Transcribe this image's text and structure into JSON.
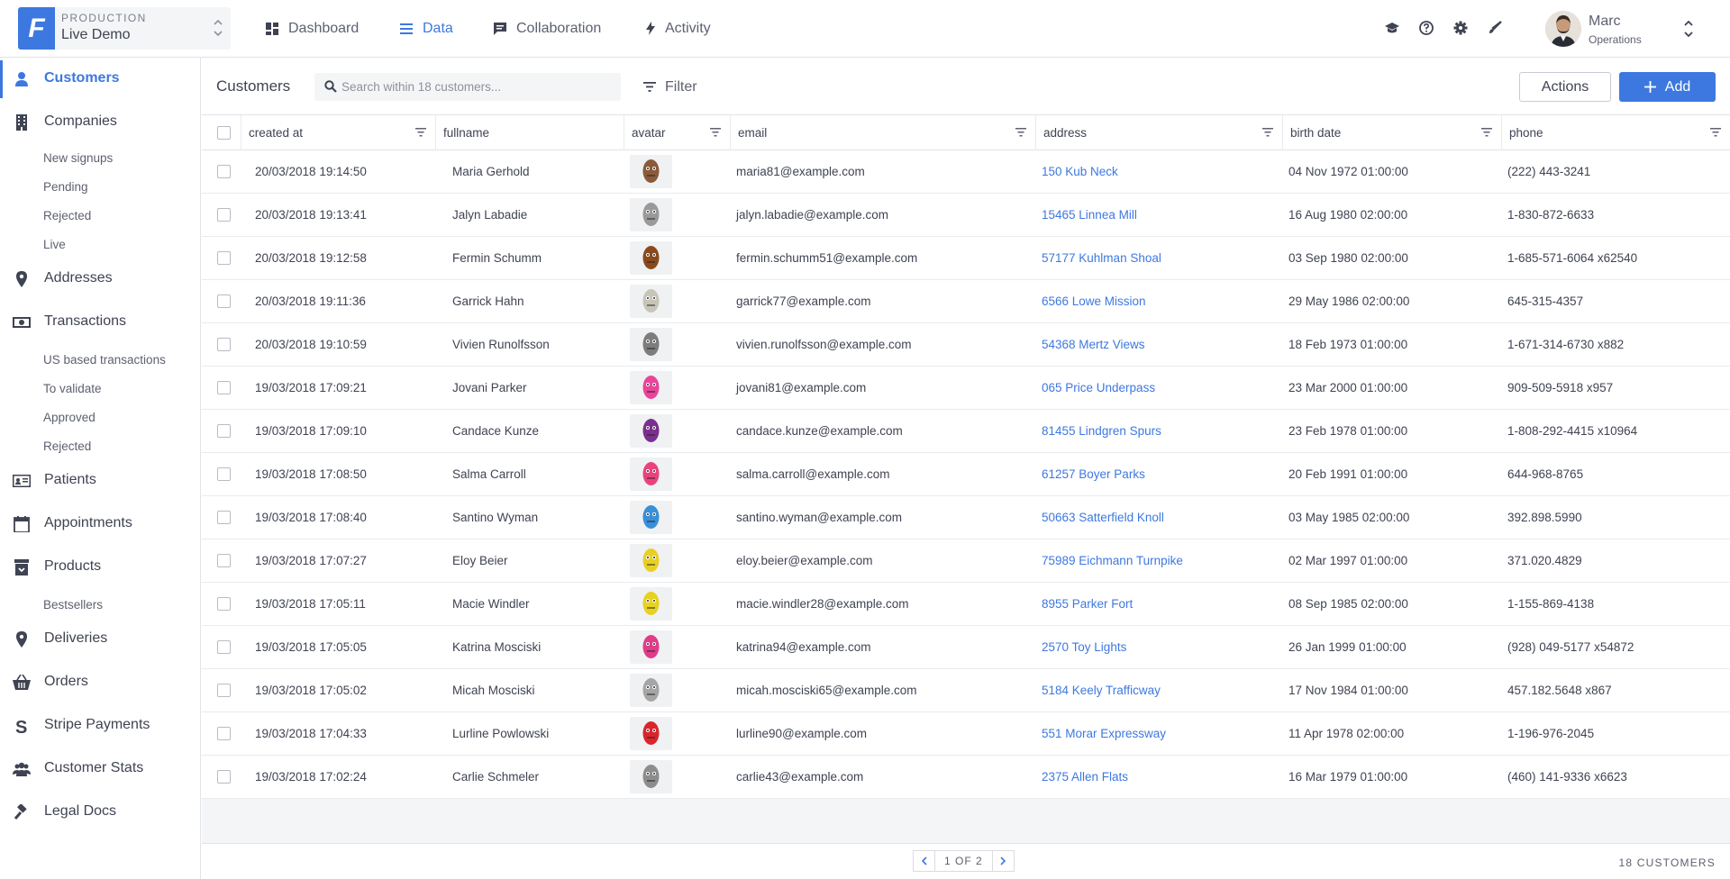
{
  "env": {
    "label": "PRODUCTION",
    "project": "Live Demo",
    "logo": "F"
  },
  "nav": [
    {
      "label": "Dashboard",
      "icon": "dashboard-icon"
    },
    {
      "label": "Data",
      "icon": "list-icon",
      "active": true
    },
    {
      "label": "Collaboration",
      "icon": "chat-icon"
    },
    {
      "label": "Activity",
      "icon": "bolt-icon"
    }
  ],
  "user": {
    "name": "Marc",
    "role": "Operations"
  },
  "sidebar": {
    "items": [
      {
        "label": "Customers",
        "icon": "user-icon",
        "active": true
      },
      {
        "label": "Companies",
        "icon": "building-icon"
      },
      {
        "label": "New signups"
      },
      {
        "label": "Pending"
      },
      {
        "label": "Rejected"
      },
      {
        "label": "Live"
      },
      {
        "label": "Addresses",
        "icon": "map-pin-icon"
      },
      {
        "label": "Transactions",
        "icon": "money-icon"
      },
      {
        "label": "US based transactions"
      },
      {
        "label": "To validate"
      },
      {
        "label": "Approved"
      },
      {
        "label": "Rejected"
      },
      {
        "label": "Patients",
        "icon": "id-card-icon"
      },
      {
        "label": "Appointments",
        "icon": "calendar-icon"
      },
      {
        "label": "Products",
        "icon": "box-icon"
      },
      {
        "label": "Bestsellers"
      },
      {
        "label": "Deliveries",
        "icon": "map-pin-icon"
      },
      {
        "label": "Orders",
        "icon": "basket-icon"
      },
      {
        "label": "Stripe Payments",
        "icon": "stripe-icon"
      },
      {
        "label": "Customer Stats",
        "icon": "users-icon"
      },
      {
        "label": "Legal Docs",
        "icon": "gavel-icon"
      }
    ]
  },
  "collection": {
    "title": "Customers",
    "search_placeholder": "Search within 18 customers...",
    "filter_label": "Filter",
    "actions_label": "Actions",
    "add_label": "Add"
  },
  "table": {
    "columns": [
      "created at",
      "fullname",
      "avatar",
      "email",
      "address",
      "birth date",
      "phone"
    ],
    "rows": [
      {
        "created_at": "20/03/2018 19:14:50",
        "fullname": "Maria Gerhold",
        "avatar": "#8a5a3a",
        "email": "maria81@example.com",
        "address": "150 Kub Neck",
        "birth_date": "04 Nov 1972 01:00:00",
        "phone": "(222) 443-3241"
      },
      {
        "created_at": "20/03/2018 19:13:41",
        "fullname": "Jalyn Labadie",
        "avatar": "#9a9a9a",
        "email": "jalyn.labadie@example.com",
        "address": "15465 Linnea Mill",
        "birth_date": "16 Aug 1980 02:00:00",
        "phone": "1-830-872-6633"
      },
      {
        "created_at": "20/03/2018 19:12:58",
        "fullname": "Fermin Schumm",
        "avatar": "#8b4a1c",
        "email": "fermin.schumm51@example.com",
        "address": "57177 Kuhlman Shoal",
        "birth_date": "03 Sep 1980 02:00:00",
        "phone": "1-685-571-6064 x62540"
      },
      {
        "created_at": "20/03/2018 19:11:36",
        "fullname": "Garrick Hahn",
        "avatar": "#c8c4b8",
        "email": "garrick77@example.com",
        "address": "6566 Lowe Mission",
        "birth_date": "29 May 1986 02:00:00",
        "phone": "645-315-4357"
      },
      {
        "created_at": "20/03/2018 19:10:59",
        "fullname": "Vivien Runolfsson",
        "avatar": "#7d7d7d",
        "email": "vivien.runolfsson@example.com",
        "address": "54368 Mertz Views",
        "birth_date": "18 Feb 1973 01:00:00",
        "phone": "1-671-314-6730 x882"
      },
      {
        "created_at": "19/03/2018 17:09:21",
        "fullname": "Jovani Parker",
        "avatar": "#e8459a",
        "email": "jovani81@example.com",
        "address": "065 Price Underpass",
        "birth_date": "23 Mar 2000 01:00:00",
        "phone": "909-509-5918 x957"
      },
      {
        "created_at": "19/03/2018 17:09:10",
        "fullname": "Candace Kunze",
        "avatar": "#7b2f8e",
        "email": "candace.kunze@example.com",
        "address": "81455 Lindgren Spurs",
        "birth_date": "23 Feb 1978 01:00:00",
        "phone": "1-808-292-4415 x10964"
      },
      {
        "created_at": "19/03/2018 17:08:50",
        "fullname": "Salma Carroll",
        "avatar": "#e9437e",
        "email": "salma.carroll@example.com",
        "address": "61257 Boyer Parks",
        "birth_date": "20 Feb 1991 01:00:00",
        "phone": "644-968-8765"
      },
      {
        "created_at": "19/03/2018 17:08:40",
        "fullname": "Santino Wyman",
        "avatar": "#3a8fd9",
        "email": "santino.wyman@example.com",
        "address": "50663 Satterfield Knoll",
        "birth_date": "03 May 1985 02:00:00",
        "phone": "392.898.5990"
      },
      {
        "created_at": "19/03/2018 17:07:27",
        "fullname": "Eloy Beier",
        "avatar": "#e8cf25",
        "email": "eloy.beier@example.com",
        "address": "75989 Eichmann Turnpike",
        "birth_date": "02 Mar 1997 01:00:00",
        "phone": "371.020.4829"
      },
      {
        "created_at": "19/03/2018 17:05:11",
        "fullname": "Macie Windler",
        "avatar": "#e6d21f",
        "email": "macie.windler28@example.com",
        "address": "8955 Parker Fort",
        "birth_date": "08 Sep 1985 02:00:00",
        "phone": "1-155-869-4138"
      },
      {
        "created_at": "19/03/2018 17:05:05",
        "fullname": "Katrina Mosciski",
        "avatar": "#e03c8a",
        "email": "katrina94@example.com",
        "address": "2570 Toy Lights",
        "birth_date": "26 Jan 1999 01:00:00",
        "phone": "(928) 049-5177 x54872"
      },
      {
        "created_at": "19/03/2018 17:05:02",
        "fullname": "Micah Mosciski",
        "avatar": "#a5a5a5",
        "email": "micah.mosciski65@example.com",
        "address": "5184 Keely Trafficway",
        "birth_date": "17 Nov 1984 01:00:00",
        "phone": "457.182.5648 x867"
      },
      {
        "created_at": "19/03/2018 17:04:33",
        "fullname": "Lurline Powlowski",
        "avatar": "#d9262b",
        "email": "lurline90@example.com",
        "address": "551 Morar Expressway",
        "birth_date": "11 Apr 1978 02:00:00",
        "phone": "1-196-976-2045"
      },
      {
        "created_at": "19/03/2018 17:02:24",
        "fullname": "Carlie Schmeler",
        "avatar": "#8d8d8d",
        "email": "carlie43@example.com",
        "address": "2375 Allen Flats",
        "birth_date": "16 Mar 1979 01:00:00",
        "phone": "(460) 141-9336 x6623"
      }
    ]
  },
  "pagination": {
    "text": "1 OF 2",
    "total": "18 CUSTOMERS"
  },
  "colors": {
    "accent": "#3d78e0",
    "text": "#3f4352",
    "muted": "#5d6170",
    "bg": "#f4f5f7"
  }
}
